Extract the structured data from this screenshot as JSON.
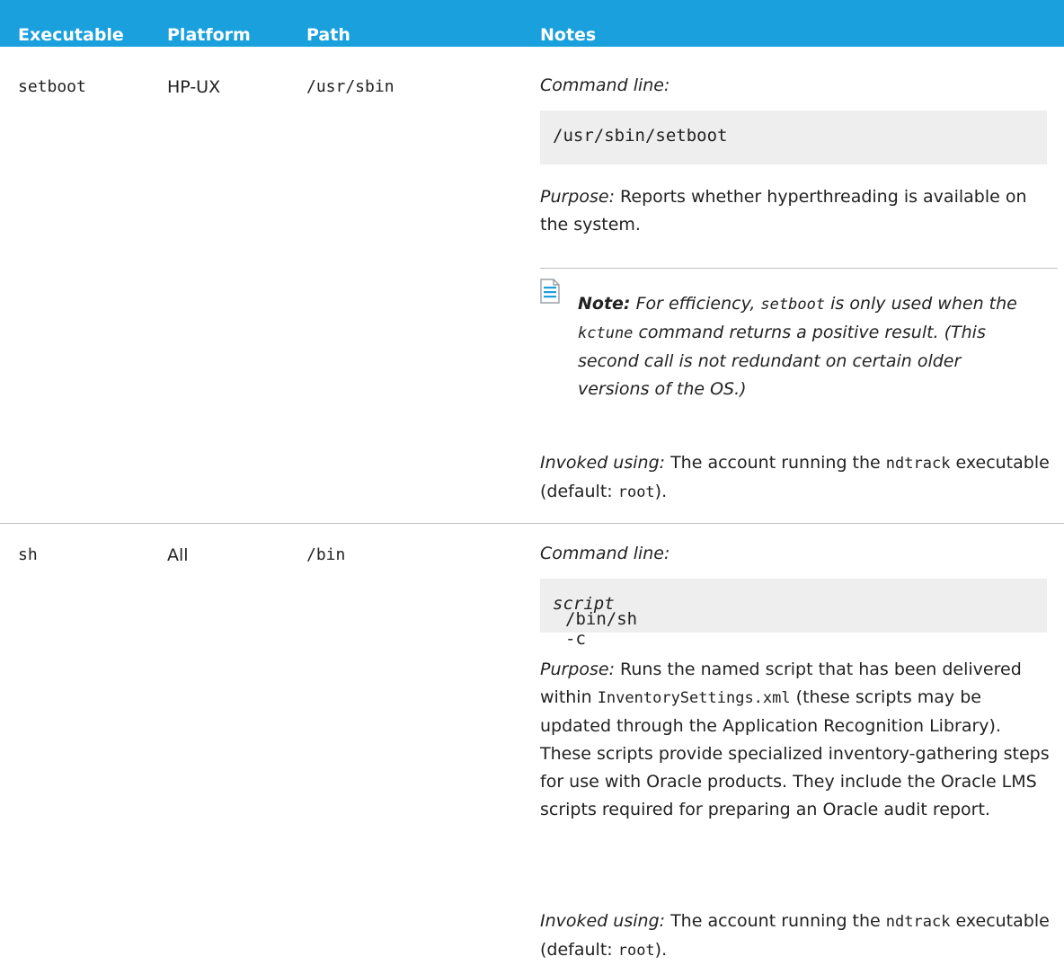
{
  "table": {
    "headers": {
      "executable": "Executable",
      "platform": "Platform",
      "path": "Path",
      "notes": "Notes"
    },
    "rows": [
      {
        "executable": "setboot",
        "platform": "HP-UX",
        "path": "/usr/sbin",
        "command_label": "Command line:",
        "command": "/usr/sbin/setboot",
        "purpose_label": "Purpose:",
        "purpose_text": "Reports whether hyperthreading is available on the system.",
        "note": {
          "label": "Note:",
          "t1": "For efficiency,",
          "c1": "setboot",
          "t2": "is only used when the",
          "c2": "kctune",
          "t3": "command returns a positive result. (This second call is not redundant on certain older versions of the OS.)"
        },
        "invoked_label": "Invoked using:",
        "invoked_t1": "The account running the",
        "invoked_c1": "ndtrack",
        "invoked_t2": "executable (default:",
        "invoked_c2": "root",
        "invoked_t3": ")."
      },
      {
        "executable": "sh",
        "platform": "All",
        "path": "/bin",
        "command_label": "Command line:",
        "command": "/bin/sh -c",
        "command_arg": "script",
        "purpose_label": "Purpose:",
        "purpose_t1": "Runs the named script that has been delivered within",
        "purpose_c1": "InventorySettings.xml",
        "purpose_t2": "(these scripts may be updated through the Application Recognition Library). These scripts provide specialized inventory-gathering steps for use with Oracle products. They include the Oracle LMS scripts required for preparing an Oracle audit report.",
        "invoked_label": "Invoked using:",
        "invoked_t1": "The account running the",
        "invoked_c1": "ndtrack",
        "invoked_t2": "executable (default:",
        "invoked_c2": "root",
        "invoked_t3": ")."
      }
    ]
  },
  "colors": {
    "header_bg": "#1aa0dc",
    "code_bg": "#eeeeee",
    "rule": "#bdbdbd"
  },
  "icons": {
    "note": "note-document-icon"
  }
}
